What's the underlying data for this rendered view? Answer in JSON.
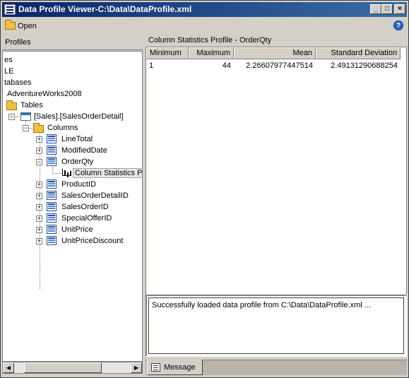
{
  "window": {
    "title": "Data Profile Viewer-C:\\Data\\DataProfile.xml",
    "controls": {
      "minimize": "_",
      "maximize": "□",
      "close": "×"
    }
  },
  "toolbar": {
    "open_label": "Open",
    "help_label": "?"
  },
  "left_panel": {
    "header": "Profiles",
    "tree": {
      "frag1": "es",
      "frag2": "LE",
      "frag3": "tabases",
      "database": "AdventureWorks2008",
      "tables_folder": "Tables",
      "table": "[Sales].[SalesOrderDetail]",
      "columns_folder": "Columns",
      "col_linetotal": "LineTotal",
      "col_modifieddate": "ModifiedDate",
      "col_orderqty": "OrderQty",
      "profile_selected": "Column Statistics Pr",
      "col_productid": "ProductID",
      "col_salesorderdetailid": "SalesOrderDetailID",
      "col_salesorderid": "SalesOrderID",
      "col_specialofferid": "SpecialOfferID",
      "col_unitprice": "UnitPrice",
      "col_unitpricediscount": "UnitPriceDiscount"
    }
  },
  "right_panel": {
    "header": "Column Statistics Profile  -  OrderQty",
    "columns": [
      "Minimum",
      "Maximum",
      "Mean",
      "Standard Deviation"
    ],
    "row": [
      "1",
      "44",
      "2.26607977447514",
      "2.49131290688254"
    ],
    "message_text": "Successfully loaded data profile from C:\\Data\\DataProfile.xml ...",
    "tab_label": "Message"
  }
}
